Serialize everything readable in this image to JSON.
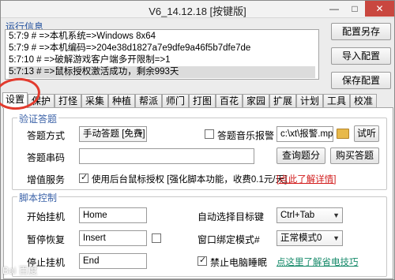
{
  "window": {
    "title": "V6_14.12.18 [按键版]",
    "min_glyph": "—",
    "max_glyph": "□",
    "close_glyph": "✕"
  },
  "log": {
    "section_label": "运行信息",
    "lines": [
      "5:7:9 # =>本机系统=>Windows 8x64",
      "5:7:9 # =>本机编码=>204e38d1827a7e9dfe9a46f5b7dfe7de",
      "5:7:10 # =>破解游戏客户端多开限制=>1",
      "5:7:13 # =>鼠标授权激活成功，剩余993天"
    ]
  },
  "side_buttons": {
    "save_as": "配置另存",
    "import": "导入配置",
    "save": "保存配置"
  },
  "tabs": [
    "设置",
    "保护",
    "打怪",
    "采集",
    "种植",
    "帮派",
    "师门",
    "打图",
    "百花",
    "家园",
    "扩展",
    "计划",
    "工具",
    "校准"
  ],
  "verify": {
    "group_title": "验证答题",
    "method_label": "答题方式",
    "method_value": "手动答题 [免费]",
    "music_label": "答题音乐报警",
    "music_path": "c:\\xt\\报警.mp3",
    "listen_button": "试听",
    "code_label": "答题串码",
    "code_value": "",
    "query_button": "查询题分",
    "buy_button": "购买答题",
    "service_label": "增值服务",
    "service_text": "使用后台鼠标授权 [强化脚本功能，收费0.1元/天]",
    "service_link": "[点此了解详情]"
  },
  "script": {
    "group_title": "脚本控制",
    "start_label": "开始挂机",
    "start_key": "Home",
    "pause_label": "暂停恢复",
    "pause_key": "Insert",
    "stop_label": "停止挂机",
    "stop_key": "End",
    "auto_target_label": "自动选择目标键",
    "auto_target_value": "Ctrl+Tab",
    "bind_mode_label": "窗口绑定模式#",
    "bind_mode_value": "正常模式0",
    "no_sleep_label": "禁止电脑睡眠",
    "sleep_link": "点这里了解省电技巧"
  },
  "watermark": "Bai 百度"
}
